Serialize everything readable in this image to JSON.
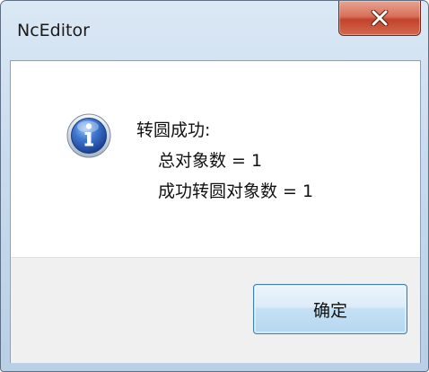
{
  "window": {
    "title": "NcEditor"
  },
  "titlebar": {
    "close_icon": "close-icon"
  },
  "message": {
    "icon": "info-icon",
    "line1": "转圆成功:",
    "line2": "总对象数 = 1",
    "line3": "成功转圆对象数 = 1"
  },
  "buttons": {
    "ok_label": "确定"
  },
  "colors": {
    "close_button": "#c1432a",
    "info_icon": "#2f5fb3",
    "ok_button_border": "#3c7fb1",
    "footer_bg": "#f0f0f0"
  }
}
